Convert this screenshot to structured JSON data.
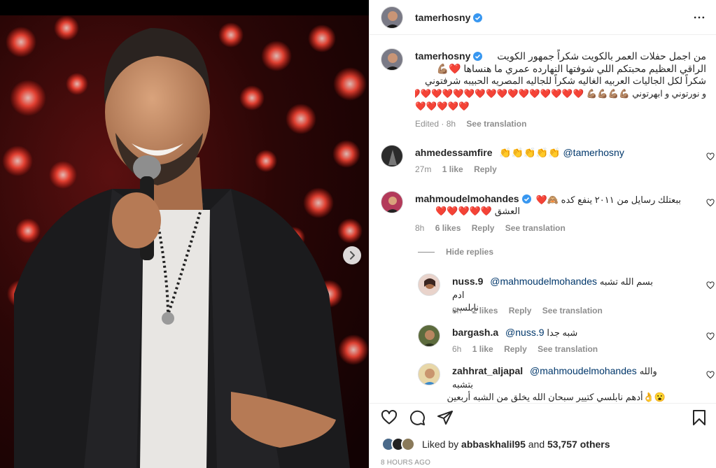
{
  "post": {
    "author": "tamerhosny",
    "caption_line1": "من اجمل حفلات العمر بالكويت شكراً جمهور الكويت",
    "caption_line2": "الراقي العظيم محبتكم اللي شوفتها النهارده عمري ما هنساها ❤️💪🏽",
    "caption_line3": "شكراً لكل الجاليات العربيه الغاليه شكراً للجاليه المصريه الحبيبه شرفتوني",
    "caption_line4": "و نورتوني و ابهرتوني 💪🏽💪🏽💪🏽💪🏽",
    "caption_hearts": "❤️❤️❤️❤️❤️❤️❤️❤️❤️❤️❤️❤️❤️❤️❤️❤️❤️❤️❤️❤️❤️❤️",
    "caption_hearts2": "❤️❤️❤️❤️❤️",
    "edited": "Edited · 8h",
    "see_translation": "See translation"
  },
  "comments": [
    {
      "user": "ahmedessamfire",
      "emoji": "👏👏👏👏👏",
      "mention": "@tamerhosny",
      "time": "27m",
      "likes": "1 like",
      "reply": "Reply"
    },
    {
      "user": "mahmoudelmohandes",
      "text_line1": "ببعتلك رسايل من ٢٠١١ ينفع كده 🙈❤️",
      "text_line2": "العشق ❤️❤️❤️❤️❤️",
      "time": "8h",
      "likes": "6 likes",
      "reply": "Reply",
      "see_translation": "See translation"
    }
  ],
  "hide_replies": "Hide replies",
  "replies": [
    {
      "user": "nuss.9",
      "mention": "@mahmoudelmohandes",
      "text_line1": "بسم الله تشبه ادم",
      "text_line2": "نابلسي",
      "time": "8h",
      "likes": "2 likes",
      "reply": "Reply",
      "see_translation": "See translation"
    },
    {
      "user": "bargash.a",
      "mention": "@nuss.9",
      "text_line1": "شبه جدا",
      "time": "6h",
      "likes": "1 like",
      "reply": "Reply",
      "see_translation": "See translation"
    },
    {
      "user": "zahhrat_aljapal",
      "mention": "@mahmoudelmohandes",
      "text_line1": "والله بتشبه",
      "text_line2": "😮👌أدهم نابلسي كتيير سبحان الله يخلق من الشبه أربعين"
    }
  ],
  "likes": {
    "prefix": "Liked by",
    "user": "abbaskhalil95",
    "conj": "and",
    "others": "53,757 others"
  },
  "time_ago": "8 HOURS AGO",
  "icons": {
    "verified": "verified-badge-icon",
    "more": "more-horizontal-icon",
    "like": "heart-outline-icon",
    "comment": "comment-icon",
    "share": "paper-plane-icon",
    "save": "bookmark-icon",
    "next": "chevron-right-icon"
  },
  "colors": {
    "verified": "#3897f0",
    "link": "#00376b",
    "muted": "#8e8e8e"
  }
}
